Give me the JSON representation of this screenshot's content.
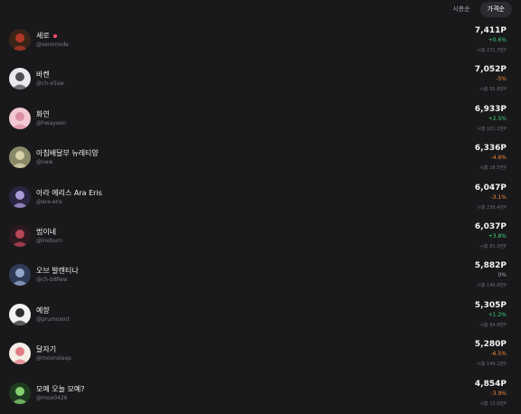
{
  "tabs": [
    {
      "label": "시총순",
      "active": false
    },
    {
      "label": "가격순",
      "active": true
    }
  ],
  "colors": {
    "background": "#19191b",
    "up": "#3ecf7a",
    "down": "#f08a3c",
    "live": "#ff4d6d"
  },
  "rows": [
    {
      "name": "세로",
      "live": true,
      "handle": "@seromode",
      "price": "7,411P",
      "change": "+0.6%",
      "dir": "up",
      "mcap": "시총 272.7만P",
      "avatar": {
        "bg": "#3a2418",
        "fg": "#c0392b",
        "icon": "avatar-sero"
      }
    },
    {
      "name": "바켄",
      "live": false,
      "handle": "@ch-x5sw",
      "price": "7,052P",
      "change": "-5%",
      "dir": "down",
      "mcap": "시총 95.8만P",
      "avatar": {
        "bg": "#e9e9ee",
        "fg": "#3d3d44",
        "icon": "avatar-bakeun"
      }
    },
    {
      "name": "화연",
      "live": false,
      "handle": "@hwayeon",
      "price": "6,933P",
      "change": "+2.5%",
      "dir": "up",
      "mcap": "시총 101.2만P",
      "avatar": {
        "bg": "#f3c8d3",
        "fg": "#d98aa0",
        "icon": "avatar-hwayeon"
      }
    },
    {
      "name": "아침배달부 뉴레티양",
      "live": false,
      "handle": "@new",
      "price": "6,336P",
      "change": "-4.6%",
      "dir": "down",
      "mcap": "시총 28.5만P",
      "avatar": {
        "bg": "#8a8a6a",
        "fg": "#e0d9b0",
        "icon": "avatar-new"
      }
    },
    {
      "name": "아라 에리스 Ara Eris",
      "live": false,
      "handle": "@ara-eris",
      "price": "6,047P",
      "change": "-3.1%",
      "dir": "down",
      "mcap": "시총 236.4만P",
      "avatar": {
        "bg": "#2a2440",
        "fg": "#b8a8e8",
        "icon": "avatar-ara-eris"
      }
    },
    {
      "name": "범이네",
      "live": false,
      "handle": "@ineburn",
      "price": "6,037P",
      "change": "+3.8%",
      "dir": "up",
      "mcap": "시총 81.3만P",
      "avatar": {
        "bg": "#2d1a1f",
        "fg": "#c94b5c",
        "icon": "avatar-ineburn"
      }
    },
    {
      "name": "오브 발렌티나",
      "live": false,
      "handle": "@ch-b8fww",
      "price": "5,882P",
      "change": "0%",
      "dir": "flat",
      "mcap": "시총 146.8만P",
      "avatar": {
        "bg": "#2f3b55",
        "fg": "#9fb4d8",
        "icon": "avatar-valentina"
      }
    },
    {
      "name": "예향",
      "live": false,
      "handle": "@prumosmt",
      "price": "5,305P",
      "change": "+1.2%",
      "dir": "up",
      "mcap": "시총 84.9만P",
      "avatar": {
        "bg": "#f2f2f2",
        "fg": "#1a1a1a",
        "icon": "avatar-yehyang"
      }
    },
    {
      "name": "달자기",
      "live": false,
      "handle": "@moonsleep",
      "price": "5,280P",
      "change": "-6.5%",
      "dir": "down",
      "mcap": "시총 144.1만P",
      "avatar": {
        "bg": "#f4eee6",
        "fg": "#e0707a",
        "icon": "avatar-moonsleep"
      }
    },
    {
      "name": "모예 오늘 모예?",
      "live": false,
      "handle": "@moe0426",
      "price": "4,854P",
      "change": "-3.9%",
      "dir": "down",
      "mcap": "시총 15.0만P",
      "avatar": {
        "bg": "#1e3a1e",
        "fg": "#8fe07a",
        "icon": "avatar-moe"
      }
    }
  ]
}
